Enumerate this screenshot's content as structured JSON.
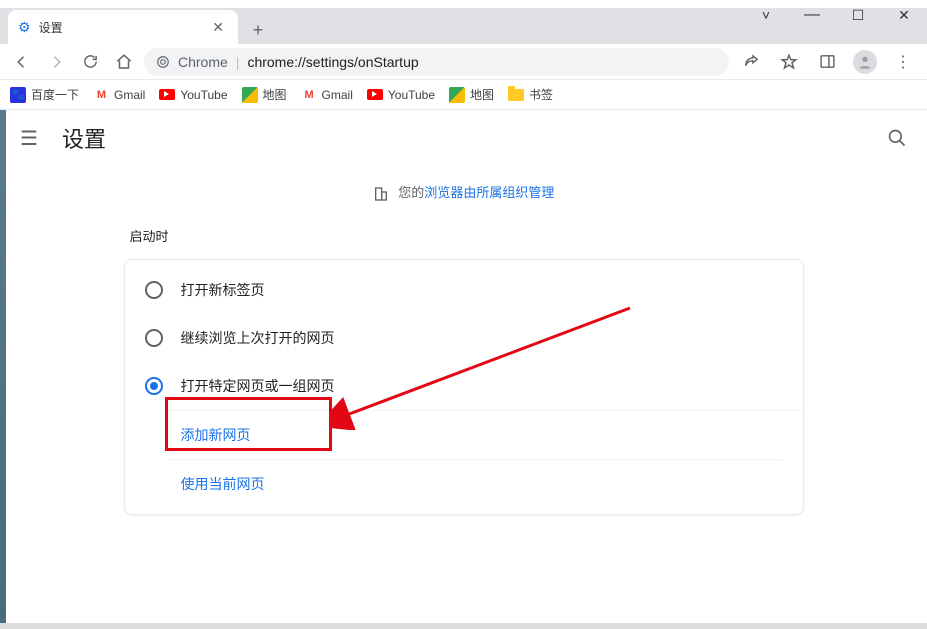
{
  "window": {
    "tab_title": "设置",
    "url_prefix": "Chrome",
    "url_path": "chrome://settings/onStartup"
  },
  "bookmarks": [
    {
      "label": "百度一下",
      "icon": "baidu"
    },
    {
      "label": "Gmail",
      "icon": "gmail"
    },
    {
      "label": "YouTube",
      "icon": "youtube"
    },
    {
      "label": "地图",
      "icon": "maps"
    },
    {
      "label": "Gmail",
      "icon": "gmail"
    },
    {
      "label": "YouTube",
      "icon": "youtube"
    },
    {
      "label": "地图",
      "icon": "maps"
    },
    {
      "label": "书签",
      "icon": "folder"
    }
  ],
  "settings": {
    "app_title": "设置",
    "managed_prefix": "您的",
    "managed_link": "浏览器由所属组织管理",
    "section_title": "启动时",
    "options": [
      {
        "label": "打开新标签页",
        "selected": false
      },
      {
        "label": "继续浏览上次打开的网页",
        "selected": false
      },
      {
        "label": "打开特定网页或一组网页",
        "selected": true
      }
    ],
    "sub_add": "添加新网页",
    "sub_use_current": "使用当前网页"
  }
}
